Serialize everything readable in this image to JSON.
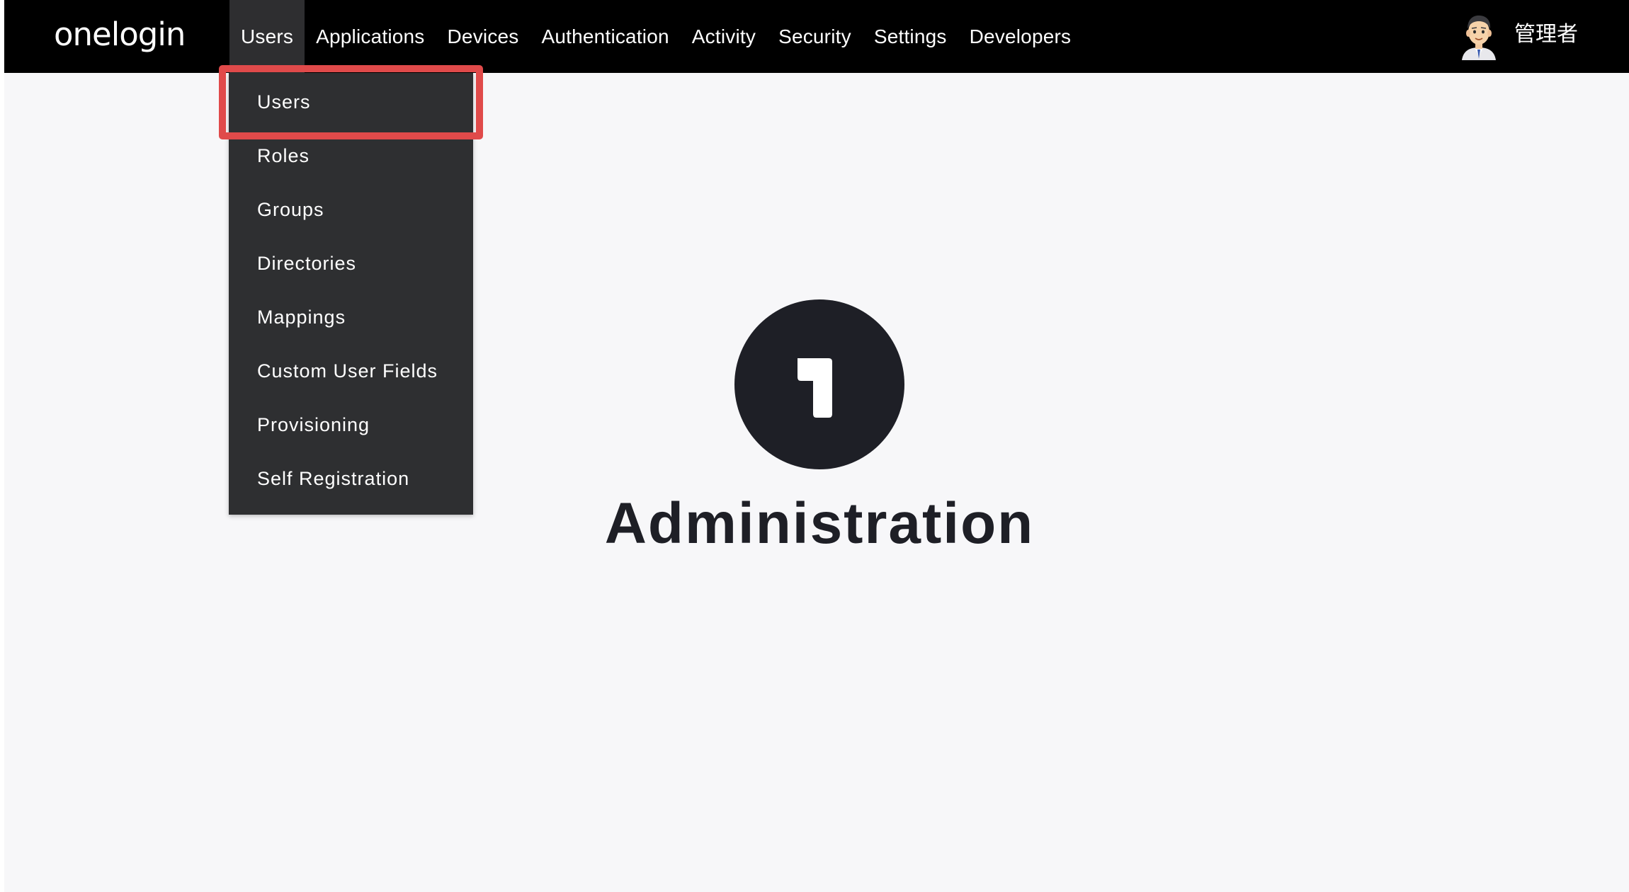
{
  "header": {
    "logo_text": "onelogin",
    "nav_items": [
      "Users",
      "Applications",
      "Devices",
      "Authentication",
      "Activity",
      "Security",
      "Settings",
      "Developers"
    ],
    "active_nav": "Users",
    "user_name": "管理者",
    "avatar_icon": "avatar-icon"
  },
  "dropdown": {
    "items": [
      "Users",
      "Roles",
      "Groups",
      "Directories",
      "Mappings",
      "Custom User Fields",
      "Provisioning",
      "Self Registration"
    ],
    "highlighted_item": "Users",
    "highlight_color": "#e04a4a"
  },
  "hero": {
    "logo_glyph": "1",
    "title": "Administration"
  },
  "colors": {
    "topbar": "#000000",
    "dropdown_bg": "#2e2f31",
    "page_bg": "#f7f7f9",
    "hero_dark": "#1e1f26"
  }
}
